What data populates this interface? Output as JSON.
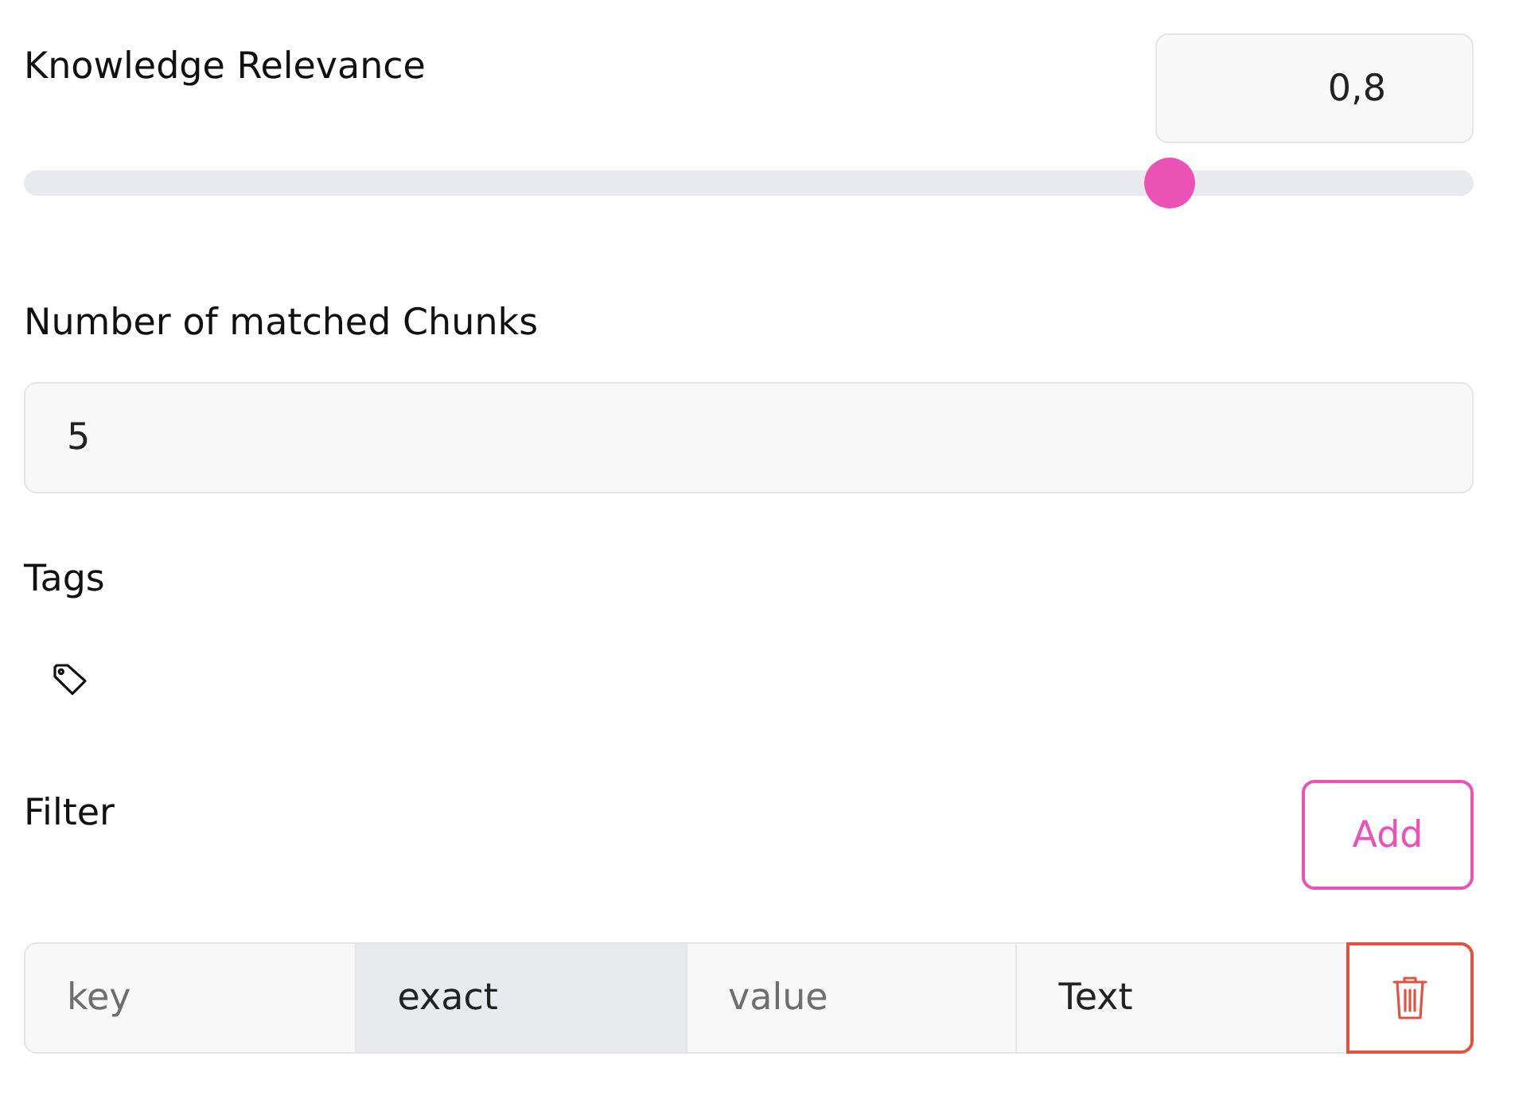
{
  "relevance": {
    "label": "Knowledge Relevance",
    "value": "0,8",
    "level": 0.79
  },
  "chunks": {
    "label": "Number of matched Chunks",
    "value": "5"
  },
  "tags": {
    "label": "Tags"
  },
  "filter": {
    "label": "Filter",
    "add_button": "Add",
    "fields": [
      {
        "kind": "input",
        "placeholder": "key",
        "disabled": false
      },
      {
        "kind": "select",
        "value": "exact",
        "disabled": true
      },
      {
        "kind": "input",
        "placeholder": "value",
        "disabled": false
      },
      {
        "kind": "select",
        "value": "Text",
        "disabled": false
      }
    ]
  }
}
